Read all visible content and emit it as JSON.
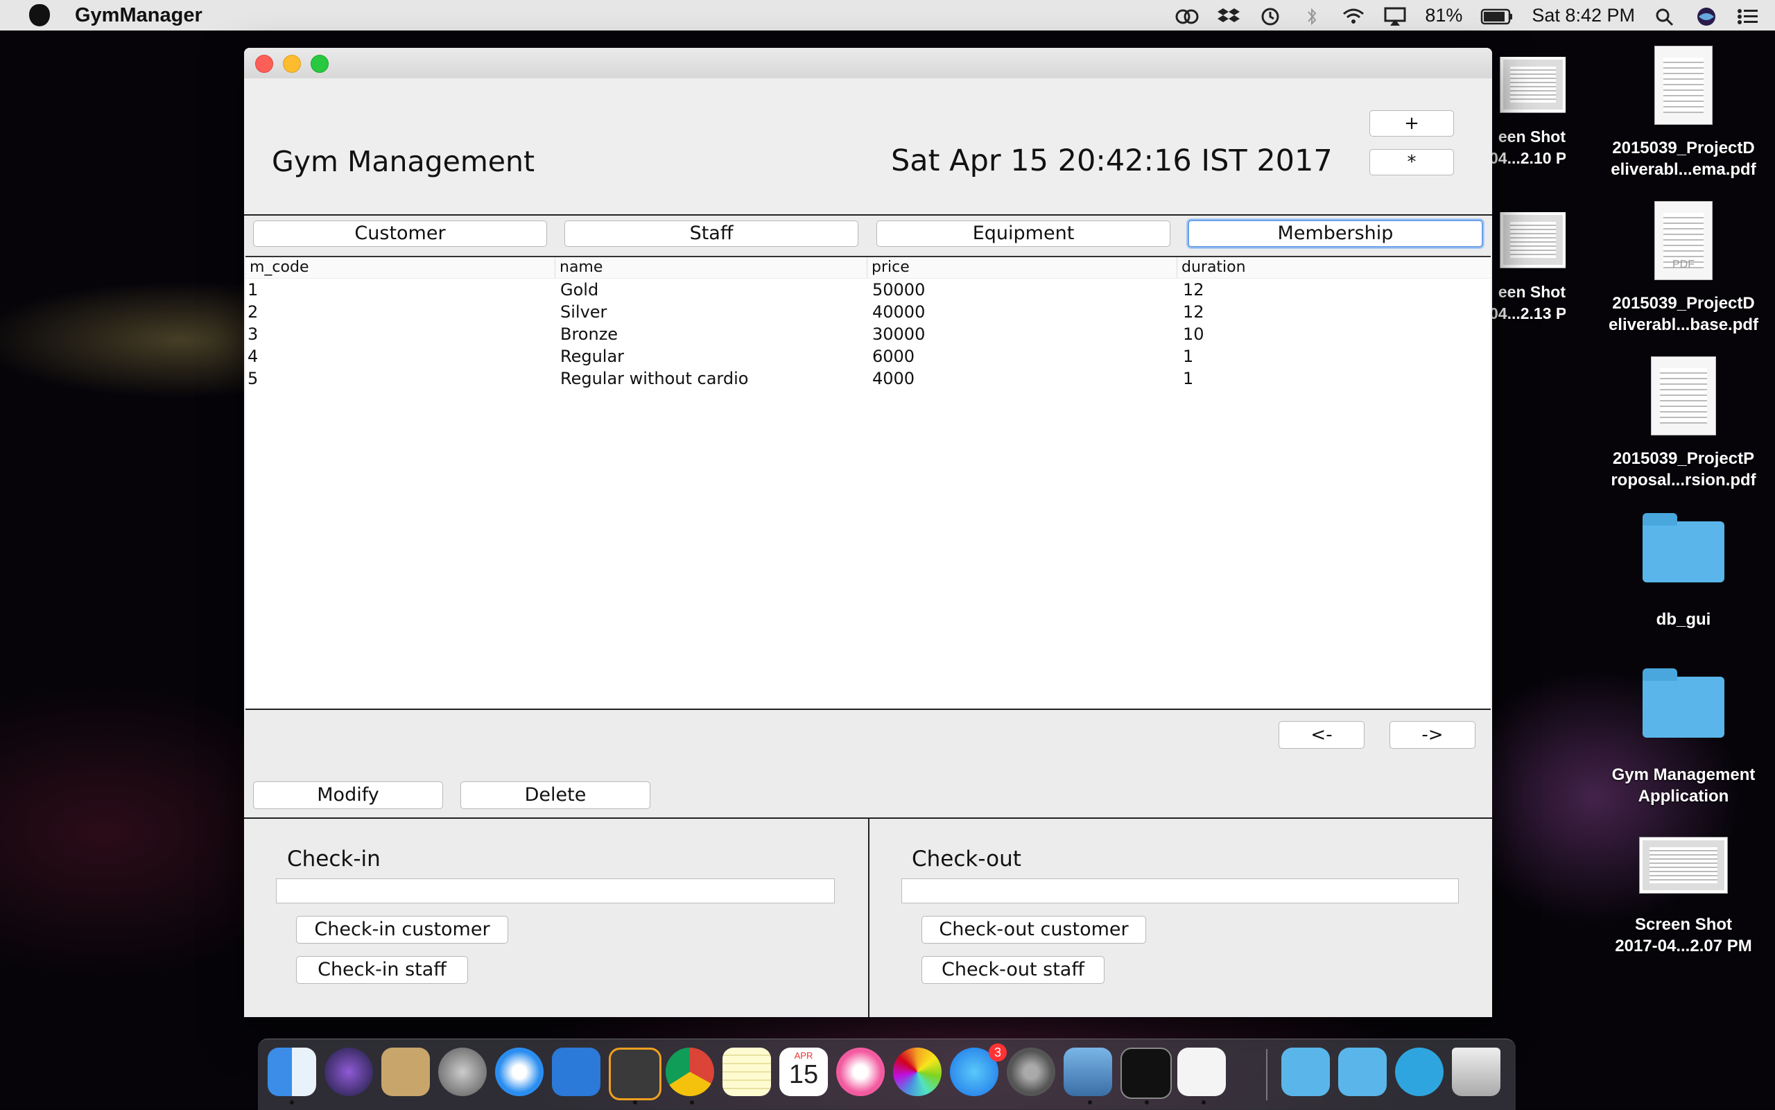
{
  "menubar": {
    "app_name": "GymManager",
    "battery": "81%",
    "clock": "Sat 8:42 PM"
  },
  "desktop": {
    "icons": [
      {
        "label": "een Shot\n04...2.10 PM"
      },
      {
        "label": "2015039_ProjectD\neliverabl...ema.pdf"
      },
      {
        "label": "een Shot\n04...2.13 PM"
      },
      {
        "label": "2015039_ProjectD\neliverabl...base.pdf"
      },
      {
        "label": "2015039_ProjectP\nroposal...rsion.pdf"
      },
      {
        "label": "db_gui"
      },
      {
        "label": "Gym Management\nApplication"
      },
      {
        "label": "Screen Shot\n2017-04...2.07 PM"
      }
    ],
    "pdf_badge": "PDF"
  },
  "window": {
    "title": "Gym Management",
    "datetime": "Sat Apr 15 20:42:16 IST 2017",
    "plus_label": "+",
    "star_label": "*",
    "tabs": [
      {
        "label": "Customer"
      },
      {
        "label": "Staff"
      },
      {
        "label": "Equipment"
      },
      {
        "label": "Membership"
      }
    ],
    "table": {
      "columns": [
        "m_code",
        "name",
        "price",
        "duration"
      ],
      "rows": [
        [
          "1",
          "Gold",
          "50000",
          "12"
        ],
        [
          "2",
          "Silver",
          "40000",
          "12"
        ],
        [
          "3",
          "Bronze",
          "30000",
          "10"
        ],
        [
          "4",
          "Regular",
          "6000",
          "1"
        ],
        [
          "5",
          "Regular without cardio",
          "4000",
          "1"
        ]
      ]
    },
    "prev_label": "<-",
    "next_label": "->",
    "modify_label": "Modify",
    "delete_label": "Delete",
    "checkin": {
      "title": "Check-in",
      "input_value": "",
      "customer_btn": "Check-in customer",
      "staff_btn": "Check-in staff"
    },
    "checkout": {
      "title": "Check-out",
      "input_value": "",
      "customer_btn": "Check-out customer",
      "staff_btn": "Check-out staff"
    }
  },
  "dock": {
    "calendar_month": "APR",
    "calendar_day": "15",
    "appstore_badge": "3"
  }
}
